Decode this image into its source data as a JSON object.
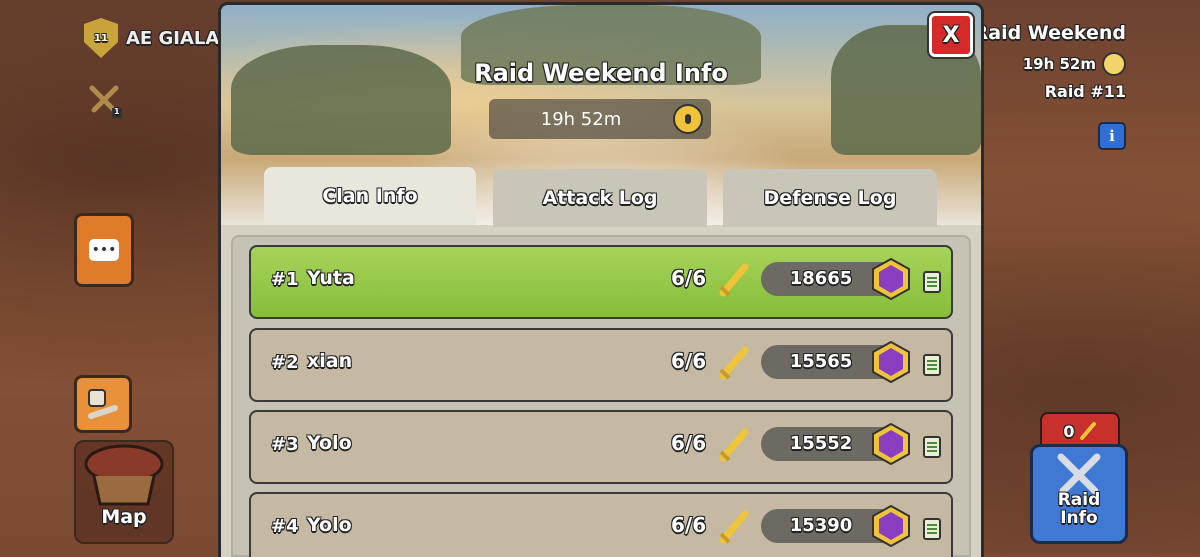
{
  "hud": {
    "clan_level": "11",
    "clan_name": "AE GIALA",
    "badge_count": "1",
    "map_label": "Map",
    "right_title": "Raid Weekend",
    "right_timer": "19h 52m",
    "right_raid": "Raid #11",
    "info_symbol": "i",
    "raid_attacks_count": "0",
    "raid_info_line1": "Raid",
    "raid_info_line2": "Info"
  },
  "modal": {
    "title": "Raid Weekend Info",
    "timer": "19h 52m",
    "close_label": "X",
    "tabs": [
      {
        "label": "Clan Info",
        "active": true
      },
      {
        "label": "Attack Log",
        "active": false
      },
      {
        "label": "Defense Log",
        "active": false
      }
    ]
  },
  "members": [
    {
      "rank": "#1",
      "name": "Yuta",
      "attacks": "6/6",
      "capital_gold": "18665"
    },
    {
      "rank": "#2",
      "name": "xian",
      "attacks": "6/6",
      "capital_gold": "15565"
    },
    {
      "rank": "#3",
      "name": "Yolo",
      "attacks": "6/6",
      "capital_gold": "15552"
    },
    {
      "rank": "#4",
      "name": "Yolo",
      "attacks": "6/6",
      "capital_gold": "15390"
    }
  ],
  "colors": {
    "highlight_row": "#96c84a",
    "row": "#c5b9a3",
    "gem": "#8a3fc0",
    "close": "#d62a2a",
    "accent_blue": "#3f79d3"
  }
}
